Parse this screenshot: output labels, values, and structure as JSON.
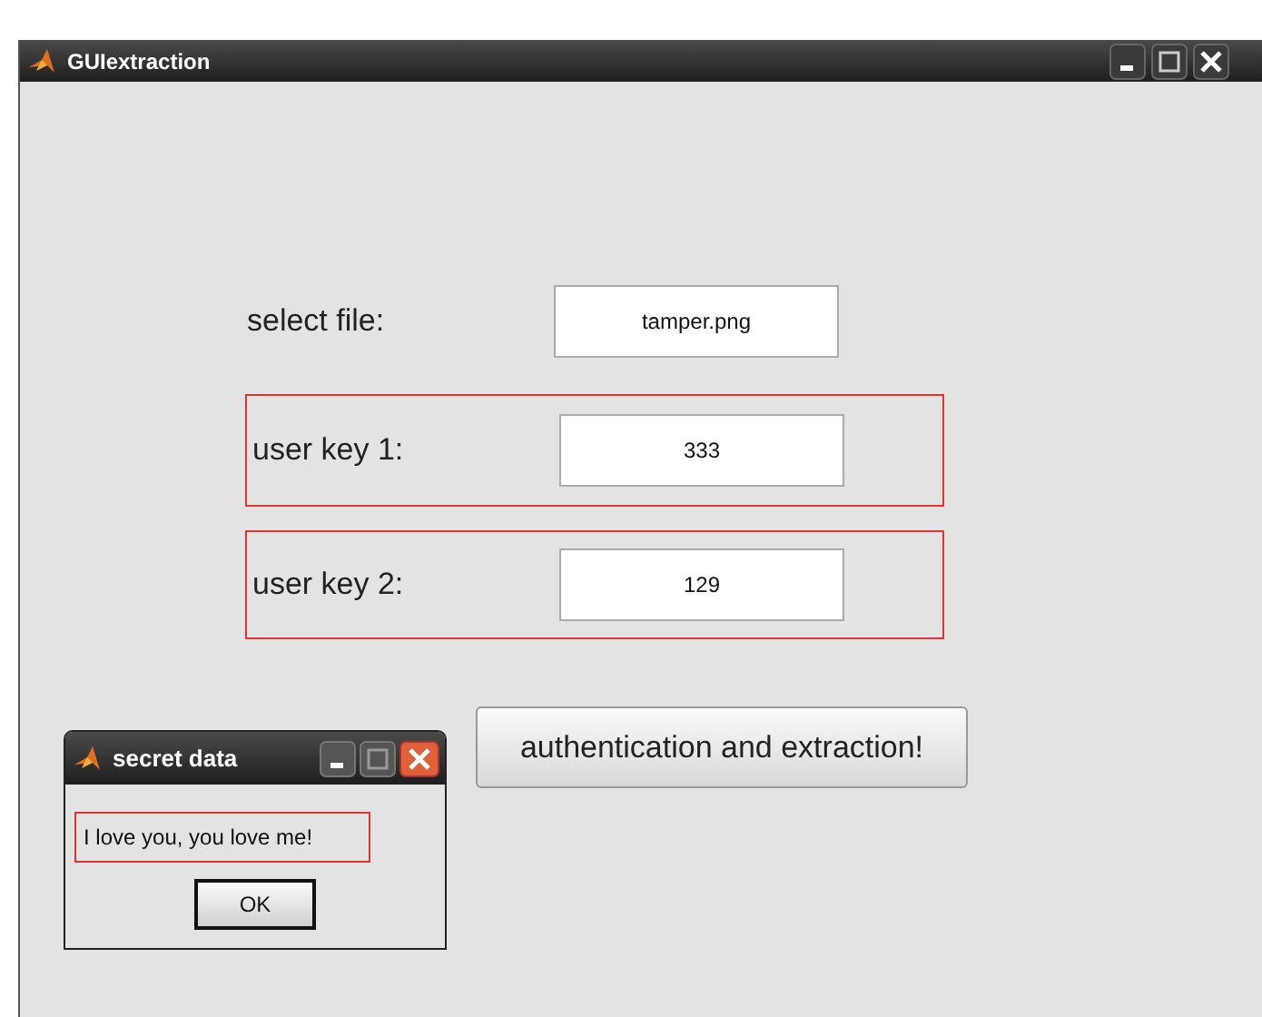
{
  "window": {
    "title": "GUIextraction"
  },
  "rows": [
    {
      "kind": "plain",
      "label": "select file:",
      "value": "tamper.png"
    },
    {
      "kind": "boxed",
      "label": "user key 1:",
      "value": "333"
    },
    {
      "kind": "boxed",
      "label": "user key 2:",
      "value": "129"
    }
  ],
  "action_button": "authentication and extraction!",
  "dialog": {
    "title": "secret data",
    "message": "I love you, you love me!",
    "button": "OK"
  }
}
